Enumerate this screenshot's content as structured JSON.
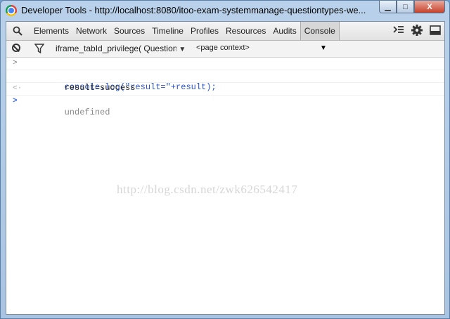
{
  "window": {
    "title": "Developer Tools - http://localhost:8080/itoo-exam-systemmanage-questiontypes-we...",
    "buttons": {
      "minimize": "▁",
      "maximize": "□",
      "close": "X"
    }
  },
  "tabs": [
    "Elements",
    "Network",
    "Sources",
    "Timeline",
    "Profiles",
    "Resources",
    "Audits",
    "Console"
  ],
  "active_tab": "Console",
  "filter": {
    "frame_select": "iframe_tabId_privilege( Question'",
    "context_select": "<page context>"
  },
  "console": {
    "input": "console.log(\"result=\"+result);",
    "output": "result=success",
    "return_value": "undefined",
    "prompt_symbol": ">",
    "input_symbol": ">",
    "return_symbol": "<·"
  },
  "watermark": "http://blog.csdn.net/zwk626542417",
  "colors": {
    "active_tab_bg": "#d7d7d7",
    "command_text": "#2a55c8",
    "prompt": "#3a6ce0"
  }
}
